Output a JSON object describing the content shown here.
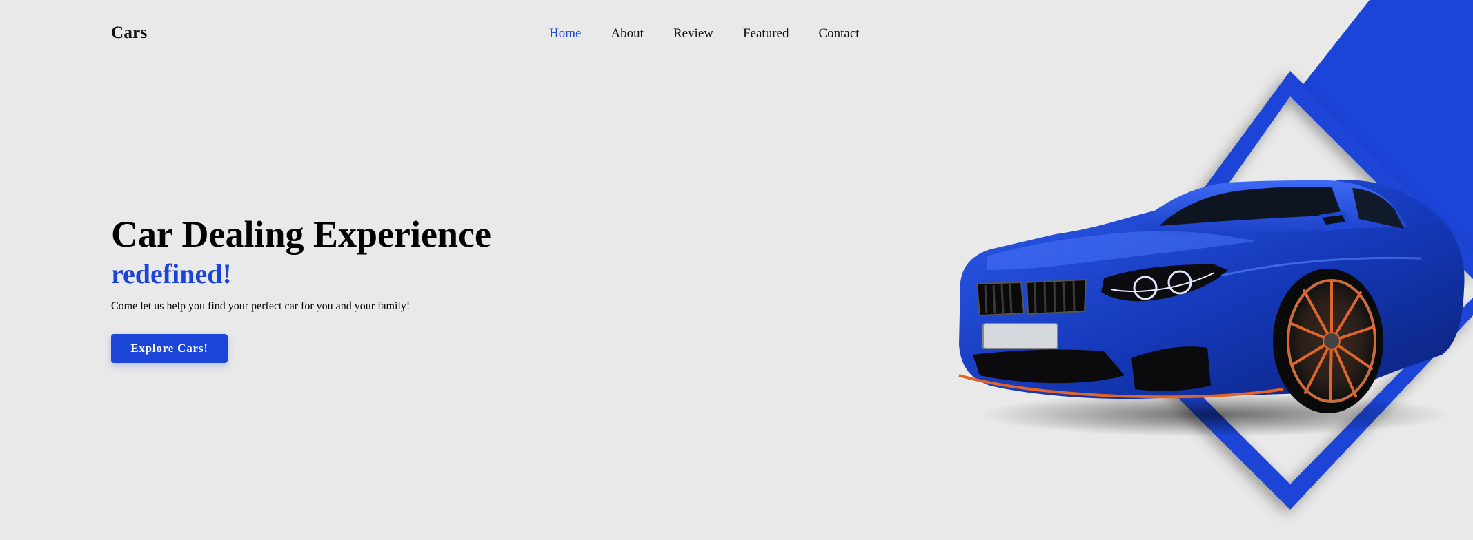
{
  "header": {
    "logo": "Cars",
    "nav": [
      {
        "label": "Home",
        "active": true
      },
      {
        "label": "About",
        "active": false
      },
      {
        "label": "Review",
        "active": false
      },
      {
        "label": "Featured",
        "active": false
      },
      {
        "label": "Contact",
        "active": false
      }
    ]
  },
  "hero": {
    "title": "Car Dealing Experience",
    "accent": "redefined!",
    "subtitle": "Come let us help you find your perfect car for you and your family!",
    "cta_label": "Explore Cars!"
  },
  "colors": {
    "accent": "#1b44d8",
    "background": "#e9e9e9",
    "text": "#111111"
  },
  "graphic": {
    "subject": "blue sports car",
    "decoration": "blue diamond frame"
  }
}
